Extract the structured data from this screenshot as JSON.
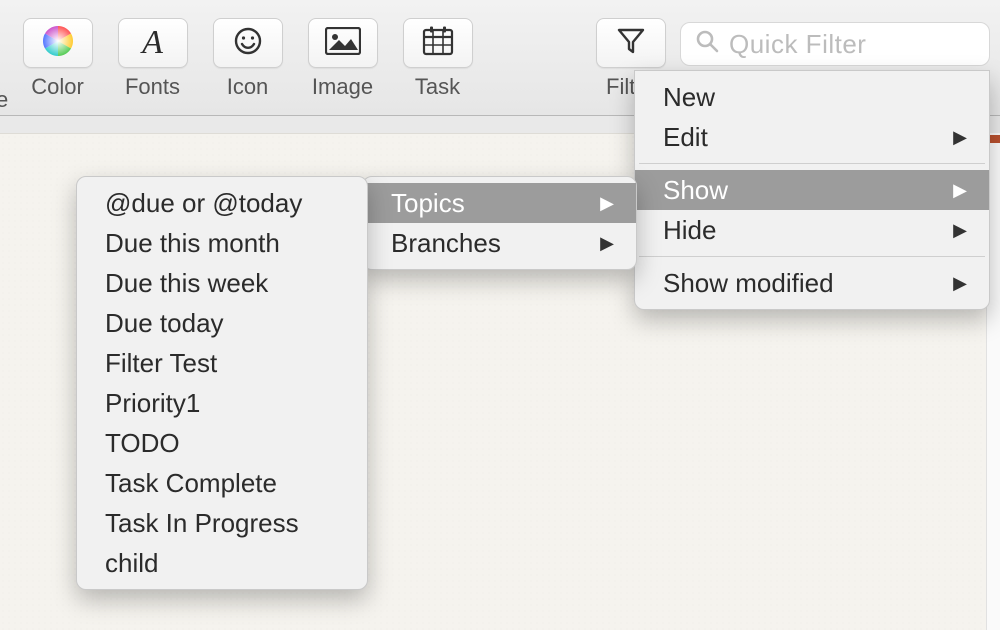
{
  "toolbar": {
    "cutoff_letter": "e",
    "items": [
      {
        "id": "color",
        "label": "Color"
      },
      {
        "id": "fonts",
        "label": "Fonts"
      },
      {
        "id": "icon",
        "label": "Icon"
      },
      {
        "id": "image",
        "label": "Image"
      },
      {
        "id": "task",
        "label": "Task"
      }
    ],
    "filter_label": "Filter",
    "quick_filter_placeholder": "Quick Filter"
  },
  "menus": {
    "main": [
      {
        "label": "New",
        "submenu": false
      },
      {
        "label": "Edit",
        "submenu": true
      },
      {
        "sep": true
      },
      {
        "label": "Show",
        "submenu": true,
        "highlight": true
      },
      {
        "label": "Hide",
        "submenu": true
      },
      {
        "sep": true
      },
      {
        "label": "Show modified",
        "submenu": true
      }
    ],
    "sub1": [
      {
        "label": "Topics",
        "submenu": true,
        "highlight": true
      },
      {
        "label": "Branches",
        "submenu": true
      }
    ],
    "sub2": [
      {
        "label": "@due or @today"
      },
      {
        "label": "Due this month"
      },
      {
        "label": "Due this week"
      },
      {
        "label": "Due today"
      },
      {
        "label": "Filter Test"
      },
      {
        "label": "Priority1"
      },
      {
        "label": "TODO"
      },
      {
        "label": "Task Complete"
      },
      {
        "label": "Task In Progress"
      },
      {
        "label": "child"
      }
    ]
  }
}
